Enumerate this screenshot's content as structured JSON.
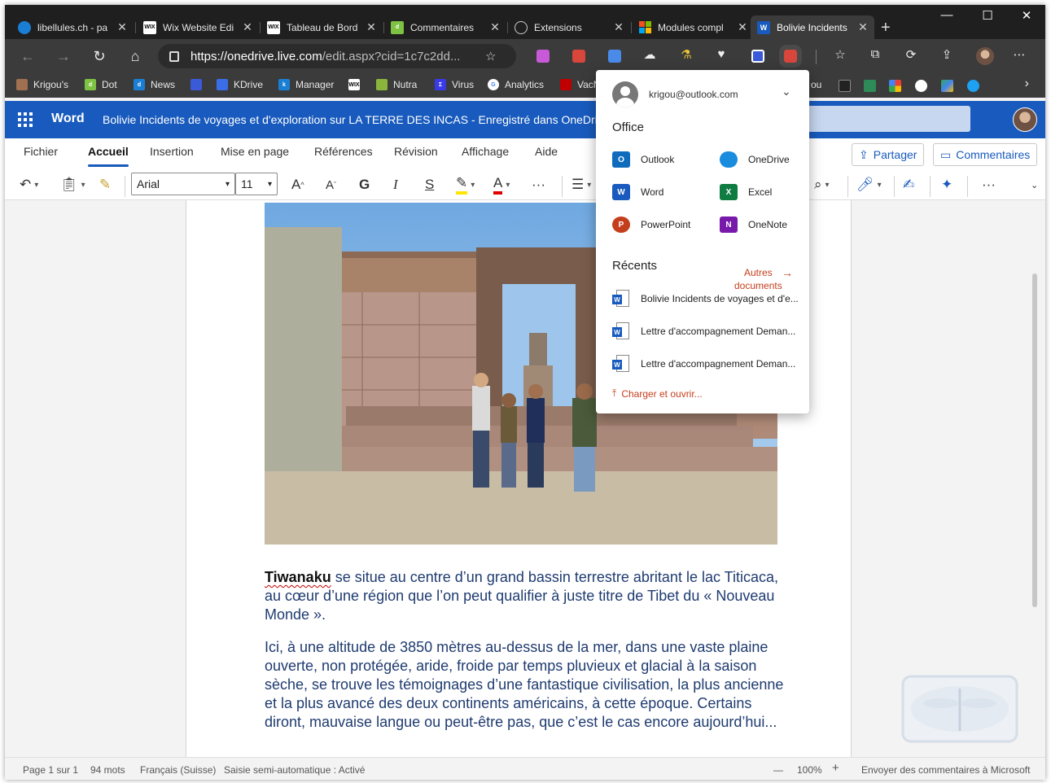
{
  "browser": {
    "tabs": [
      {
        "label": "libellules.ch - pa",
        "icon": "libellules-favicon",
        "color": "#1a7fd4"
      },
      {
        "label": "Wix Website Edi",
        "icon": "wix-favicon",
        "color": "#ffffff"
      },
      {
        "label": "Tableau de Bord",
        "icon": "wix-favicon",
        "color": "#ffffff"
      },
      {
        "label": "Commentaires",
        "icon": "dot-favicon",
        "color": "#7dc242"
      },
      {
        "label": "Extensions",
        "icon": "puzzle-icon",
        "color": "#cccccc"
      },
      {
        "label": "Modules compl",
        "icon": "microsoft-favicon",
        "color": "#f25022"
      },
      {
        "label": "Bolivie Incidents",
        "icon": "word-favicon",
        "color": "#185abd"
      }
    ],
    "new_tab": "+",
    "window_controls": {
      "minimize": "—",
      "maximize": "☐",
      "close": "✕"
    },
    "url_host": "https://onedrive.live.com",
    "url_path": "/edit.aspx?cid=1c7c2dd...",
    "bookmarks": [
      {
        "label": "Krigou's",
        "color": "#a07050"
      },
      {
        "label": "Dot",
        "color": "#7dc242"
      },
      {
        "label": "News",
        "color": "#1a7fd4"
      },
      {
        "label": "",
        "color": "#3a5ad8"
      },
      {
        "label": "KDrive",
        "color": "#3a6ee8"
      },
      {
        "label": "Manager",
        "color": "#1a7fd4"
      },
      {
        "label": "",
        "color": "#ffffff"
      },
      {
        "label": "Nutra",
        "color": "#8ab43c"
      },
      {
        "label": "Virus",
        "color": "#3a3ae8"
      },
      {
        "label": "Analytics",
        "color": "#dddddd"
      },
      {
        "label": "VacN",
        "color": "#c00000"
      }
    ],
    "bookmarks_right_text": "ou",
    "colors": {
      "dark_bg": "#1f1f1f",
      "toolbar_bg": "#3b3b3b"
    }
  },
  "word": {
    "app_name": "Word",
    "doc_title": "Bolivie Incidents de voyages et d'exploration sur LA TERRE DES INCAS  -  Enregistré dans OneDrive",
    "brand_color": "#185abd",
    "ribbon_tabs": [
      "Fichier",
      "Accueil",
      "Insertion",
      "Mise en page",
      "Références",
      "Révision",
      "Affichage",
      "Aide"
    ],
    "active_tab": "Accueil",
    "share_label": "Partager",
    "comments_label": "Commentaires",
    "font_name": "Arial",
    "font_size": "11",
    "tools": {
      "grow": "A",
      "shrink": "A",
      "bold": "G",
      "italic": "I",
      "strike": "S",
      "more": "···"
    }
  },
  "document": {
    "para1_keyword": "Tiwanaku",
    "para1_rest": " se situe au centre d’un grand bassin terrestre abritant le lac Titicaca, au cœur d’une région que l’on peut qualifier à juste titre de Tibet du « Nouveau Monde ».",
    "para2": "Ici, à une altitude de 3850 mètres au-dessus de la mer, dans une vaste plaine ouverte, non protégée, aride, froide par temps pluvieux et glacial à la saison sèche, se trouve les témoignages d’une fantastique civilisation, la plus ancienne et la plus avancé des deux continents américains, à cette époque. Certains diront, mauvaise langue ou peut-être pas, que c’est le cas encore aujourd’hui..."
  },
  "status": {
    "page": "Page 1 sur 1",
    "words": "94 mots",
    "language": "Français (Suisse)",
    "autosave": "Saisie semi-automatique : Activé",
    "zoom_minus": "—",
    "zoom": "100%",
    "zoom_plus": "+",
    "feedback": "Envoyer des commentaires à Microsoft"
  },
  "office_popup": {
    "email": "krigou@outlook.com",
    "section_office": "Office",
    "apps": [
      {
        "label": "Outlook",
        "icon": "outlook-icon",
        "color": "#0f6cbd"
      },
      {
        "label": "OneDrive",
        "icon": "onedrive-icon",
        "color": "#1a8cde"
      },
      {
        "label": "Word",
        "icon": "word-icon",
        "color": "#185abd"
      },
      {
        "label": "Excel",
        "icon": "excel-icon",
        "color": "#107c41"
      },
      {
        "label": "PowerPoint",
        "icon": "powerpoint-icon",
        "color": "#c43e1c"
      },
      {
        "label": "OneNote",
        "icon": "onenote-icon",
        "color": "#7719aa"
      }
    ],
    "section_recent": "Récents",
    "more_docs_line1": "Autres",
    "more_docs_line2": "documents",
    "recent_docs": [
      "Bolivie Incidents de voyages et d'e...",
      "Lettre d'accompagnement Deman...",
      "Lettre d'accompagnement Deman..."
    ],
    "upload_label": "Charger et ouvrir..."
  }
}
